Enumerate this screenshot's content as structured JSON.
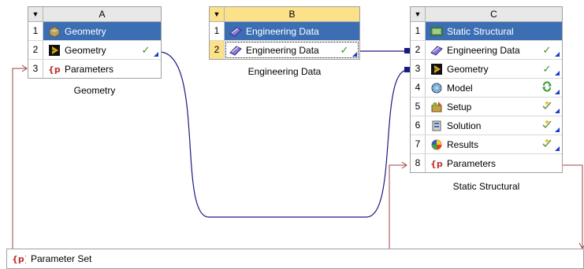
{
  "systems": [
    {
      "letter": "A",
      "caption": "Geometry",
      "rows": [
        {
          "num": "1",
          "label": "Geometry",
          "icon": "geometry-system-icon",
          "title": true
        },
        {
          "num": "2",
          "label": "Geometry",
          "icon": "geometry-cell-icon",
          "status": "up-to-date"
        },
        {
          "num": "3",
          "label": "Parameters",
          "icon": "parameters-icon"
        }
      ]
    },
    {
      "letter": "B",
      "caption": "Engineering Data",
      "rows": [
        {
          "num": "1",
          "label": "Engineering Data",
          "icon": "engineering-data-system-icon",
          "title": true
        },
        {
          "num": "2",
          "label": "Engineering Data",
          "icon": "engineering-data-cell-icon",
          "status": "up-to-date",
          "selected": true
        }
      ]
    },
    {
      "letter": "C",
      "caption": "Static Structural",
      "rows": [
        {
          "num": "1",
          "label": "Static Structural",
          "icon": "static-structural-system-icon",
          "title": true
        },
        {
          "num": "2",
          "label": "Engineering Data",
          "icon": "engineering-data-cell-icon",
          "status": "up-to-date"
        },
        {
          "num": "3",
          "label": "Geometry",
          "icon": "geometry-cell-icon",
          "status": "up-to-date"
        },
        {
          "num": "4",
          "label": "Model",
          "icon": "model-icon",
          "status": "refresh-required"
        },
        {
          "num": "5",
          "label": "Setup",
          "icon": "setup-icon",
          "status": "update-required"
        },
        {
          "num": "6",
          "label": "Solution",
          "icon": "solution-icon",
          "status": "update-required"
        },
        {
          "num": "7",
          "label": "Results",
          "icon": "results-icon",
          "status": "update-required"
        },
        {
          "num": "8",
          "label": "Parameters",
          "icon": "parameters-icon"
        }
      ]
    }
  ],
  "parameter_set": {
    "label": "Parameter Set",
    "icon": "parameters-icon"
  },
  "colors": {
    "title_row": "#3c6eb4",
    "selected_header": "#fbe18a",
    "data_link": "#1a1a80",
    "parameter_link": "#a04040",
    "up_to_date_check": "#3c8c28"
  }
}
